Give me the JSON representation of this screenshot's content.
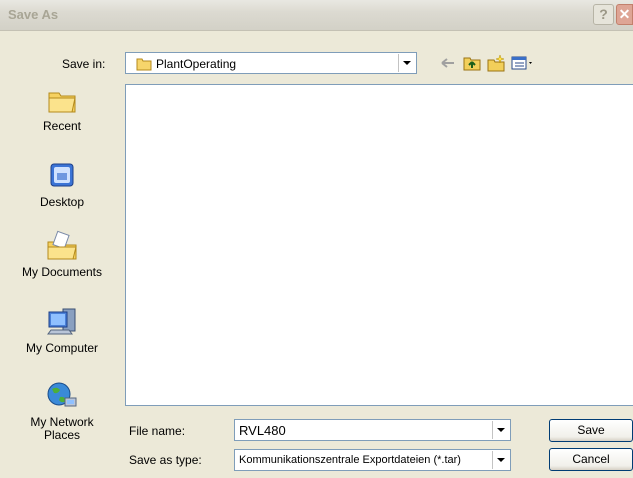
{
  "window": {
    "title": "Save As",
    "help_label": "?",
    "close_label": "✕"
  },
  "savein": {
    "label": "Save in:",
    "value": "PlantOperating"
  },
  "toolbar": {
    "icons": [
      "back-arrow-icon",
      "up-folder-icon",
      "new-folder-icon",
      "views-menu-icon"
    ]
  },
  "places": [
    {
      "label": "Recent",
      "icon": "recent-folder-icon"
    },
    {
      "label": "Desktop",
      "icon": "desktop-icon"
    },
    {
      "label": "My Documents",
      "icon": "my-documents-icon"
    },
    {
      "label": "My Computer",
      "icon": "my-computer-icon"
    },
    {
      "label": "My Network Places",
      "icon": "network-globe-icon"
    }
  ],
  "filename": {
    "label": "File name:",
    "value": "RVL480"
  },
  "filetype": {
    "label": "Save as type:",
    "value": "Kommunikationszentrale Exportdateien (*.tar)"
  },
  "buttons": {
    "save": "Save",
    "cancel": "Cancel"
  },
  "colors": {
    "dialog_bg": "#ece9d8",
    "border": "#7f9db9",
    "button_border": "#003c74"
  }
}
